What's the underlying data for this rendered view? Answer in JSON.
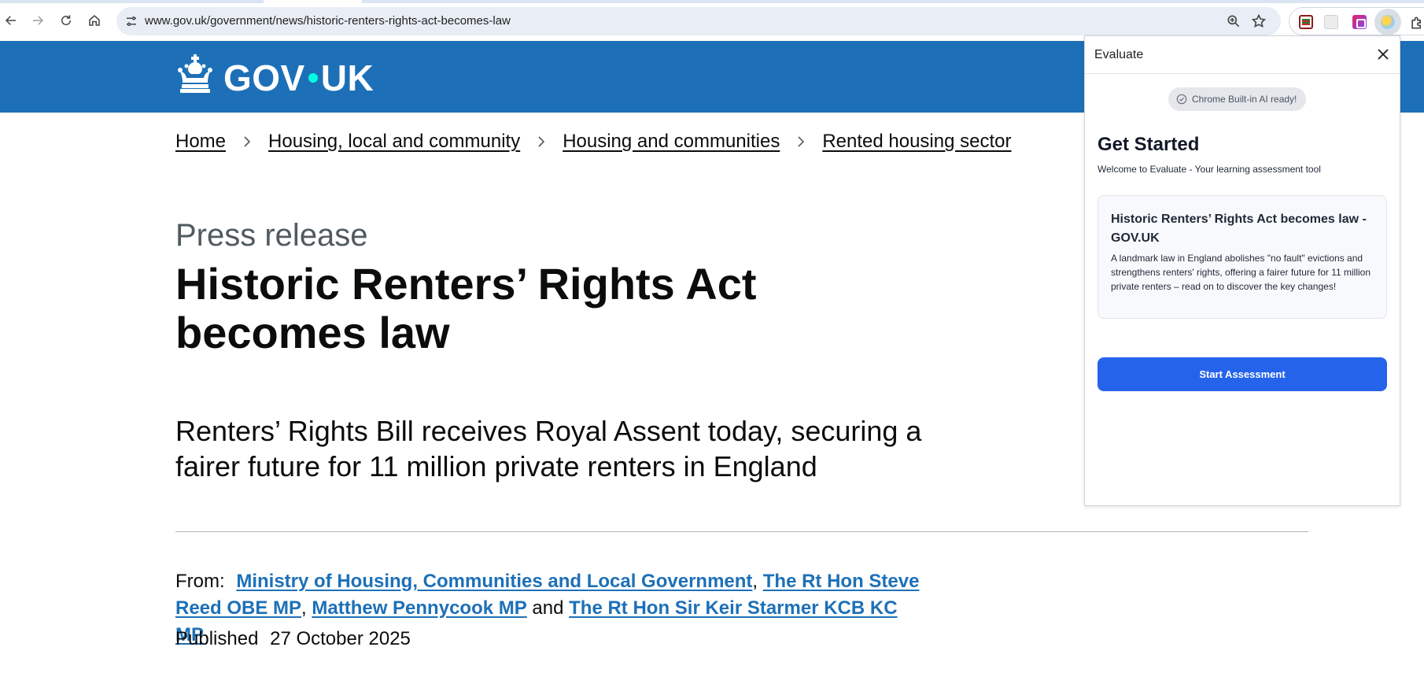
{
  "browser": {
    "url": "www.gov.uk/government/news/historic-renters-rights-act-becomes-law"
  },
  "header": {
    "logo_left": "GOV",
    "logo_right": "UK"
  },
  "breadcrumbs": [
    {
      "label": "Home"
    },
    {
      "label": "Housing, local and community"
    },
    {
      "label": "Housing and communities"
    },
    {
      "label": "Rented housing sector"
    }
  ],
  "article": {
    "caption": "Press release",
    "title": "Historic Renters’ Rights Act becomes law",
    "lede": "Renters’ Rights Bill receives Royal Assent today, securing a fairer future for 11 million private renters in England",
    "from_label": "From:",
    "from_links": [
      "Ministry of Housing, Communities and Local Government",
      "The Rt Hon Steve Reed OBE MP",
      "Matthew Pennycook MP",
      "The Rt Hon Sir Keir Starmer KCB KC MP"
    ],
    "from_sep_comma": ",",
    "from_sep_and": "and",
    "published_label": "Published",
    "published_date": "27 October 2025"
  },
  "panel": {
    "title": "Evaluate",
    "ai_status": "Chrome Built-in AI ready!",
    "heading": "Get Started",
    "subtitle": "Welcome to Evaluate - Your learning assessment tool",
    "card_title": "Historic Renters’ Rights Act becomes law - GOV.UK",
    "card_description": "A landmark law in England abolishes \"no fault\" evictions and strengthens renters' rights, offering a fairer future for 11 million private renters – read on to discover the key changes!",
    "start_button": "Start Assessment"
  },
  "colors": {
    "govuk_blue": "#1d70b8",
    "govuk_dot": "#00ffe0",
    "primary_button": "#2563eb"
  }
}
